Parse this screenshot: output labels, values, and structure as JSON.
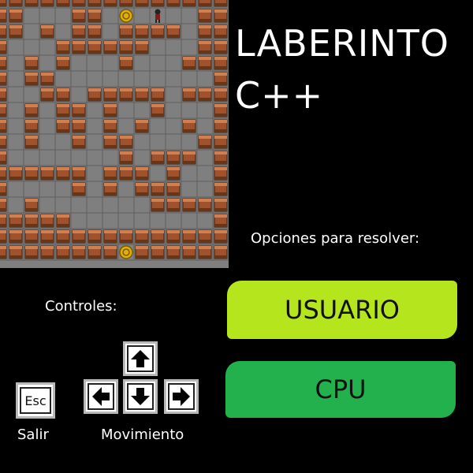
{
  "title": {
    "line1": "LABERINTO",
    "line2": "C++"
  },
  "options": {
    "label": "Opciones para resolver:",
    "user_button": "USUARIO",
    "cpu_button": "CPU"
  },
  "controls": {
    "label": "Controles:",
    "esc_key": "Esc",
    "exit_label": "Salir",
    "move_label": "Movimiento"
  },
  "colors": {
    "user_button": "#b5e61d",
    "cpu_button": "#22b14c",
    "floor": "#7f7f7f",
    "wall": "#a0522d"
  },
  "maze": {
    "rows": 17,
    "cols": 15,
    "grid": [
      "WWWWWWWWWWWWWWW",
      "WW...WW.E.S..WW",
      "WW.W.WW.WWWW.WW",
      "W...WWWWWW...WW",
      "W.W.W...W...WWW",
      "W.WW..........W",
      "W..WW.WWWWW.WWW",
      "W.W.WW.W..W...W",
      "W.W.WW.W.W..W.W",
      "W.W..W.WW....WW",
      "W.......W.WWW.W",
      "WWWWWW.WWW.W..W",
      "W....W.W.WWW..W",
      "W.W.......WWWWW",
      "WWWWW.........W",
      "WWWWWWWWWWWWWWW",
      "WWWWWWWWEWWWWWW"
    ],
    "player_icon": "player-icon",
    "coin_icon": "coin-icon"
  }
}
